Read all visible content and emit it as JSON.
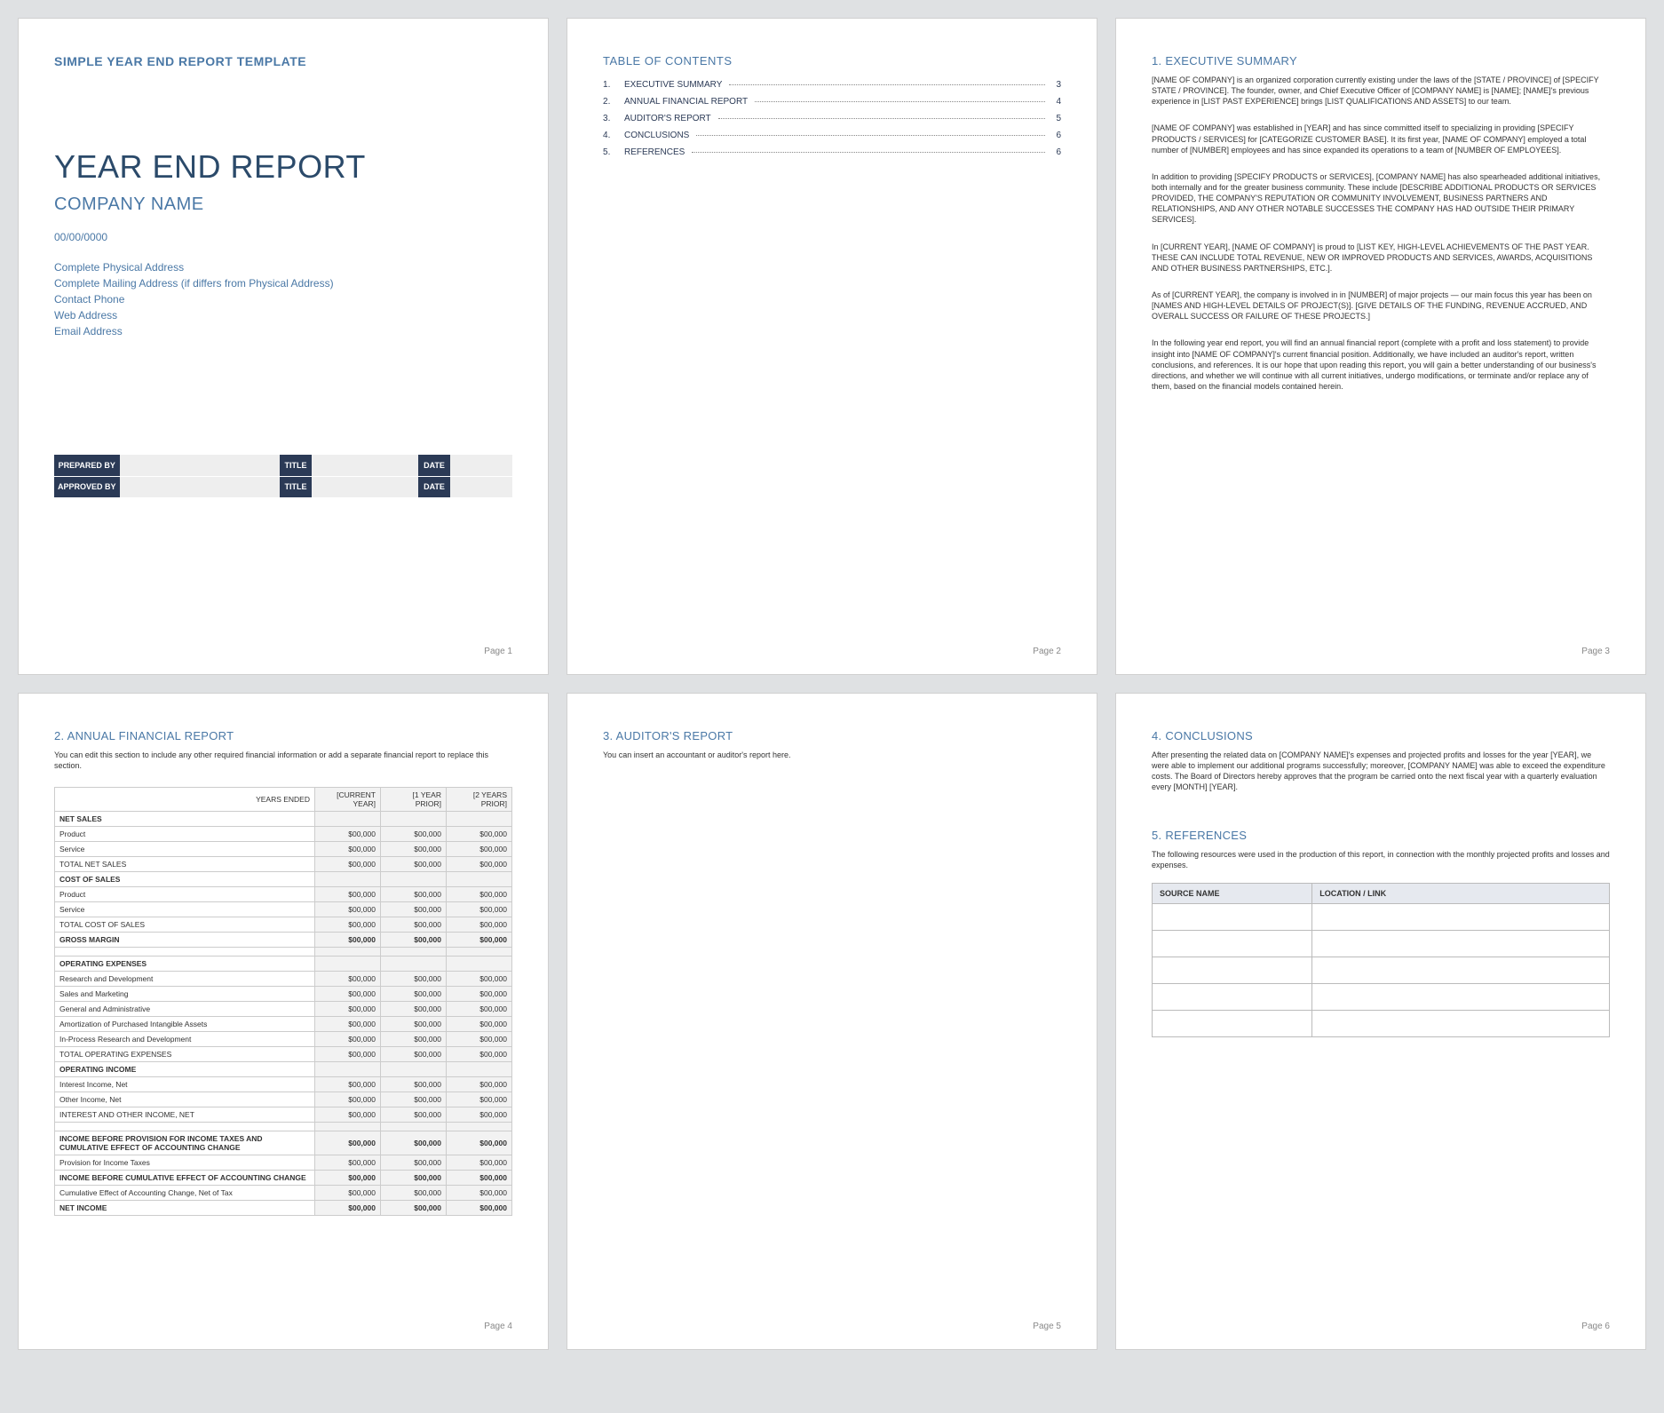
{
  "page1": {
    "template_label": "SIMPLE YEAR END REPORT TEMPLATE",
    "title": "YEAR END REPORT",
    "company": "COMPANY NAME",
    "date": "00/00/0000",
    "physical_address": "Complete Physical Address",
    "mailing_address": "Complete Mailing Address (if differs from Physical Address)",
    "contact_phone": "Contact Phone",
    "web_address": "Web Address",
    "email_address": "Email Address",
    "signoff_labels": {
      "prepared_by": "PREPARED BY",
      "approved_by": "APPROVED BY",
      "title": "TITLE",
      "date": "DATE"
    },
    "footer": "Page 1"
  },
  "page2": {
    "heading": "TABLE OF CONTENTS",
    "items": [
      {
        "label": "EXECUTIVE SUMMARY",
        "page": "3"
      },
      {
        "label": "ANNUAL FINANCIAL REPORT",
        "page": "4"
      },
      {
        "label": "AUDITOR'S REPORT",
        "page": "5"
      },
      {
        "label": "CONCLUSIONS",
        "page": "6"
      },
      {
        "label": "REFERENCES",
        "page": "6"
      }
    ],
    "footer": "Page 2"
  },
  "page3": {
    "heading": "1.  EXECUTIVE SUMMARY",
    "p1": "[NAME OF COMPANY] is an organized corporation currently existing under the laws of the [STATE / PROVINCE] of [SPECIFY STATE / PROVINCE]. The founder, owner, and Chief Executive Officer of [COMPANY NAME] is [NAME]; [NAME]'s previous experience in [LIST PAST EXPERIENCE] brings [LIST QUALIFICATIONS AND ASSETS] to our team.",
    "p2": "[NAME OF COMPANY] was established in [YEAR] and has since committed itself to specializing in providing [SPECIFY PRODUCTS / SERVICES] for [CATEGORIZE CUSTOMER BASE]. It its first year, [NAME OF COMPANY] employed a total number of [NUMBER] employees and has since expanded its operations to a team of [NUMBER OF EMPLOYEES].",
    "p3": "In addition to providing [SPECIFY PRODUCTS or SERVICES], [COMPANY NAME] has also spearheaded additional initiatives, both internally and for the greater business community. These include [DESCRIBE ADDITIONAL PRODUCTS OR SERVICES PROVIDED, THE COMPANY'S REPUTATION OR COMMUNITY INVOLVEMENT, BUSINESS PARTNERS AND RELATIONSHIPS, AND ANY OTHER NOTABLE SUCCESSES THE COMPANY HAS HAD OUTSIDE THEIR PRIMARY SERVICES].",
    "p4": "In [CURRENT YEAR], [NAME OF COMPANY] is proud to [LIST KEY, HIGH-LEVEL ACHIEVEMENTS OF THE PAST YEAR. THESE CAN INCLUDE TOTAL REVENUE, NEW OR IMPROVED PRODUCTS AND SERVICES, AWARDS, ACQUISITIONS AND OTHER BUSINESS PARTNERSHIPS, ETC.].",
    "p5": "As of [CURRENT YEAR], the company is involved in in [NUMBER] of major projects — our main focus this year has been on [NAMES AND HIGH-LEVEL DETAILS OF PROJECT(S)]. [GIVE DETAILS OF THE FUNDING, REVENUE ACCRUED, AND OVERALL SUCCESS OR FAILURE OF THESE PROJECTS.]",
    "p6": "In the following year end report, you will find an annual financial report (complete with a profit and loss statement) to provide insight into [NAME OF COMPANY]'s current financial position. Additionally, we have included an auditor's report, written conclusions, and references. It is our hope that upon reading this report, you will gain a better understanding of our business's directions, and whether we will continue with all current initiatives, undergo modifications, or terminate and/or replace any of them, based on the financial models contained herein.",
    "footer": "Page 3"
  },
  "page4": {
    "heading": "2.  ANNUAL FINANCIAL REPORT",
    "intro": "You can edit this section to include any other required financial information or add a separate financial report to replace this section.",
    "headers": {
      "years_ended": "YEARS ENDED",
      "c1": "[CURRENT YEAR]",
      "c2": "[1 YEAR PRIOR]",
      "c3": "[2 YEARS PRIOR]"
    },
    "rows": {
      "net_sales": "NET SALES",
      "product": "Product",
      "service": "Service",
      "total_net_sales": "TOTAL NET SALES",
      "cost_of_sales": "COST OF SALES",
      "total_cost_of_sales": "TOTAL COST OF SALES",
      "gross_margin": "GROSS MARGIN",
      "operating_expenses": "OPERATING EXPENSES",
      "rnd": "Research and Development",
      "sales_mkt": "Sales and Marketing",
      "gen_admin": "General and Administrative",
      "amortization": "Amortization of Purchased Intangible Assets",
      "inprocess": "In-Process Research and Development",
      "total_op_exp": "TOTAL OPERATING EXPENSES",
      "operating_income": "OPERATING INCOME",
      "interest_income": "Interest Income, Net",
      "other_income": "Other Income, Net",
      "interest_other": "INTEREST AND OTHER INCOME, NET",
      "income_before_prov": "INCOME BEFORE PROVISION FOR INCOME TAXES AND CUMULATIVE EFFECT OF ACCOUNTING CHANGE",
      "provision_income_taxes": "Provision for Income Taxes",
      "income_before_cum": "INCOME BEFORE CUMULATIVE EFFECT OF ACCOUNTING CHANGE",
      "cum_effect": "Cumulative Effect of Accounting Change, Net of Tax",
      "net_income": "NET INCOME"
    },
    "val": "$00,000",
    "footer": "Page 4"
  },
  "page5": {
    "heading": "3.  AUDITOR'S REPORT",
    "intro": "You can insert an accountant or auditor's report here.",
    "footer": "Page 5"
  },
  "page6": {
    "conclusions_heading": "4.  CONCLUSIONS",
    "conclusions_text": "After presenting the related data on [COMPANY NAME]'s expenses and projected profits and losses for the year [YEAR], we were able to implement our additional programs successfully; moreover, [COMPANY NAME] was able to exceed the expenditure costs. The Board of Directors hereby approves that the program be carried onto the next fiscal year with a quarterly evaluation every [MONTH] [YEAR].",
    "references_heading": "5.  REFERENCES",
    "references_text": "The following resources were used in the production of this report, in connection with the monthly projected profits and losses and expenses.",
    "ref_headers": {
      "source": "SOURCE NAME",
      "location": "LOCATION / LINK"
    },
    "ref_row_count": 5,
    "footer": "Page 6"
  }
}
